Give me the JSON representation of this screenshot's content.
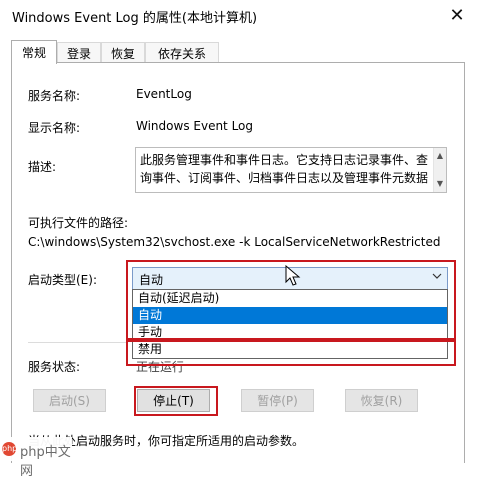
{
  "window": {
    "title": "Windows Event Log 的属性(本地计算机)",
    "close_glyph": "✕"
  },
  "tabs": [
    {
      "label": "常规",
      "active": true
    },
    {
      "label": "登录",
      "active": false
    },
    {
      "label": "恢复",
      "active": false
    },
    {
      "label": "依存关系",
      "active": false
    }
  ],
  "general": {
    "service_name_label": "服务名称:",
    "service_name_value": "EventLog",
    "display_name_label": "显示名称:",
    "display_name_value": "Windows Event Log",
    "description_label": "描述:",
    "description_value": "此服务管理事件和事件日志。它支持日志记录事件、查询事件、订阅事件、归档事件日志以及管理事件元数据",
    "path_label": "可执行文件的路径:",
    "path_value": "C:\\windows\\System32\\svchost.exe -k LocalServiceNetworkRestricted",
    "startup_type_label": "启动类型(E):",
    "startup_type_value": "自动",
    "startup_options": [
      "自动(延迟启动)",
      "自动",
      "手动",
      "禁用"
    ],
    "startup_selected_option": "自动",
    "service_status_label": "服务状态:",
    "service_status_value": "正在运行",
    "buttons": {
      "start": "启动(S)",
      "stop": "停止(T)",
      "pause": "暂停(P)",
      "resume": "恢复(R)"
    },
    "hint_text": "当从此处启动服务时，你可指定所适用的启动参数。"
  },
  "watermark": {
    "text": "php中文网",
    "logo_text": "php"
  },
  "colors": {
    "highlight": "#0078d7",
    "annotation_red": "#c8181e"
  }
}
